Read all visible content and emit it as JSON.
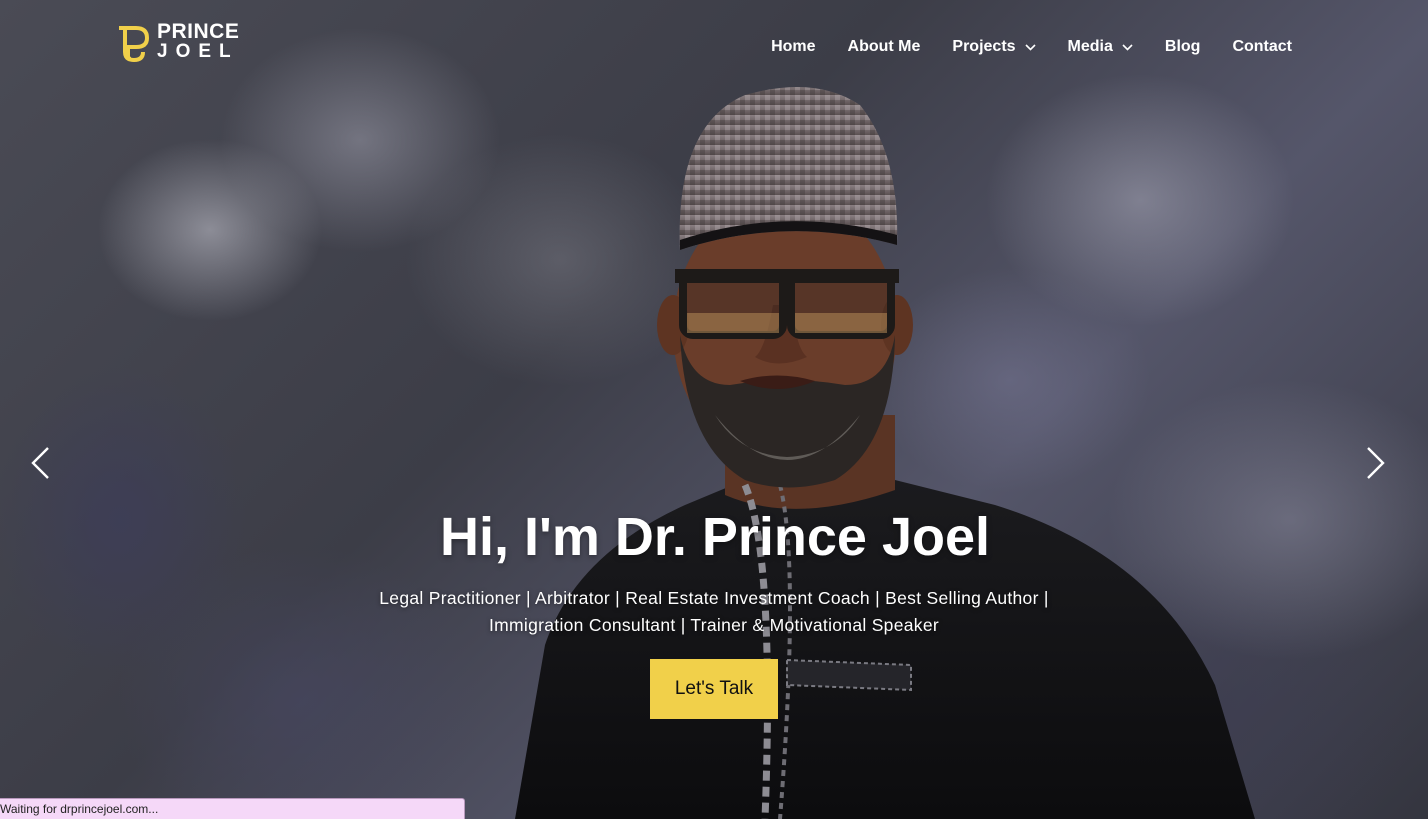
{
  "brand": {
    "line1": "PRINCE",
    "line2": "JOEL",
    "accent_color": "#f1d04a"
  },
  "nav": {
    "items": [
      {
        "label": "Home",
        "has_dropdown": false
      },
      {
        "label": "About Me",
        "has_dropdown": false
      },
      {
        "label": "Projects",
        "has_dropdown": true
      },
      {
        "label": "Media",
        "has_dropdown": true
      },
      {
        "label": "Blog",
        "has_dropdown": false
      },
      {
        "label": "Contact",
        "has_dropdown": false
      }
    ]
  },
  "hero": {
    "headline": "Hi, I'm Dr. Prince Joel",
    "subline": "Legal Practitioner | Arbitrator | Real Estate Investment Coach | Best Selling Author | Immigration Consultant | Trainer & Motivational Speaker",
    "cta_label": "Let's Talk",
    "cta_color": "#f1d04a",
    "prev_icon": "chevron-left-icon",
    "next_icon": "chevron-right-icon"
  },
  "browser_status": {
    "text": "Waiting for drprincejoel.com..."
  }
}
